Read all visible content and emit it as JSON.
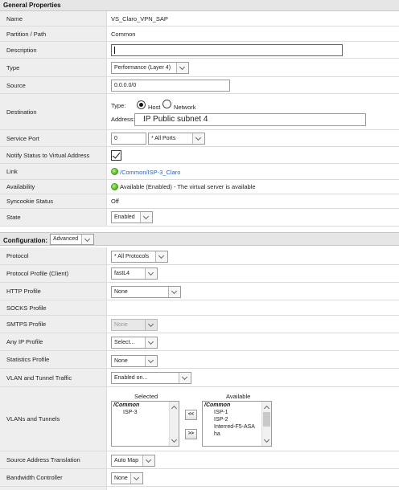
{
  "general": {
    "header": "General Properties",
    "name": {
      "label": "Name",
      "value": "VS_Claro_VPN_SAP"
    },
    "partition": {
      "label": "Partition / Path",
      "value": "Common"
    },
    "description": {
      "label": "Description",
      "value": ""
    },
    "type": {
      "label": "Type",
      "value": "Performance (Layer 4)"
    },
    "source": {
      "label": "Source",
      "value": "0.0.0.0/0"
    },
    "destination": {
      "label": "Destination",
      "type_label": "Type:",
      "host_label": "Host",
      "network_label": "Network",
      "selected": "Host",
      "address_label": "Address:",
      "address_value": "IP Public subnet 4"
    },
    "service_port": {
      "label": "Service Port",
      "value": "0",
      "select": "* All Ports"
    },
    "notify": {
      "label": "Notify Status to Virtual Address",
      "checked": true
    },
    "link": {
      "label": "Link",
      "value": "/Common/ISP-3_Claro"
    },
    "availability": {
      "label": "Availability",
      "value": "Available (Enabled) - The virtual server is available"
    },
    "syncookie": {
      "label": "Syncookie Status",
      "value": "Off"
    },
    "state": {
      "label": "State",
      "value": "Enabled"
    }
  },
  "configuration": {
    "header": "Configuration:",
    "mode": "Advanced",
    "protocol": {
      "label": "Protocol",
      "value": "* All Protocols"
    },
    "protocol_profile": {
      "label": "Protocol Profile (Client)",
      "value": "fastL4"
    },
    "http_profile": {
      "label": "HTTP Profile",
      "value": "None"
    },
    "socks_profile": {
      "label": "SOCKS Profile"
    },
    "smtps_profile": {
      "label": "SMTPS Profile",
      "value": "None"
    },
    "any_ip_profile": {
      "label": "Any IP Profile",
      "value": "Select..."
    },
    "statistics_profile": {
      "label": "Statistics Profile",
      "value": "None"
    },
    "vlan_traffic": {
      "label": "VLAN and Tunnel Traffic",
      "value": "Enabled on..."
    },
    "vlans": {
      "label": "VLANs and Tunnels",
      "selected_label": "Selected",
      "available_label": "Available",
      "selected_group": "/Common",
      "selected_items": [
        "ISP-3"
      ],
      "available_group": "/Common",
      "available_items": [
        "ISP-1",
        "ISP-2",
        "Interred-F5-ASA",
        "ha"
      ],
      "move_left": "<<",
      "move_right": ">>"
    },
    "snat": {
      "label": "Source Address Translation",
      "value": "Auto Map"
    },
    "bandwidth": {
      "label": "Bandwidth Controller",
      "value": "None"
    }
  }
}
